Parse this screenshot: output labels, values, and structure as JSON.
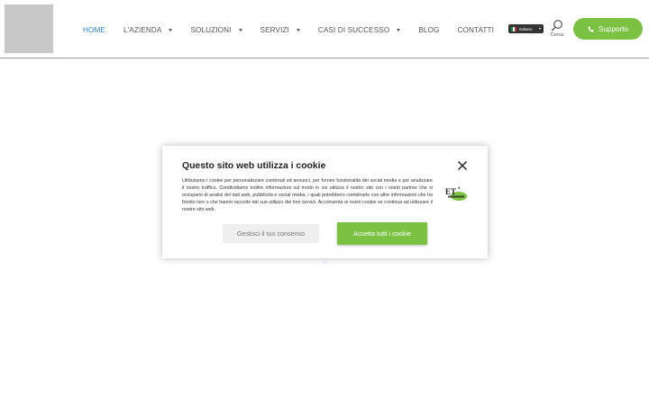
{
  "header": {
    "nav": [
      {
        "label": "Home",
        "active": true,
        "has_caret": false
      },
      {
        "label": "L'azienda",
        "active": false,
        "has_caret": true
      },
      {
        "label": "Soluzioni",
        "active": false,
        "has_caret": true
      },
      {
        "label": "Servizi",
        "active": false,
        "has_caret": true
      },
      {
        "label": "Casi di successo",
        "active": false,
        "has_caret": true
      },
      {
        "label": "Blog",
        "active": false,
        "has_caret": false
      },
      {
        "label": "Contatti",
        "active": false,
        "has_caret": false
      }
    ],
    "language": {
      "selected": "Italiano",
      "flag_icon": "italy-flag-icon"
    },
    "search": {
      "label": "Cerca",
      "icon": "search-icon"
    },
    "support_button": {
      "label": "Supporto",
      "icon": "phone-icon"
    }
  },
  "cookie_modal": {
    "title": "Questo sito web utilizza i cookie",
    "text": "Utilizziamo i cookie per personalizzare contenuti ed annunci, per fornire funzionalità dei social media e per analizzare il nostro traffico. Condividiamo inoltre informazioni sul modo in cui utilizza il nostro sito con i nostri partner che si occupano di analisi dei dati web, pubblicità e social media, i quali potrebbero combinarle con altre informazioni che ha fornito loro o che hanno raccolto dal suo utilizzo dei loro servizi. Acconsenta ai nostri cookie se continua ad utilizzare il nostro sito web.",
    "manage_label": "Gestisci il tuo consenso",
    "accept_label": "Accetta tutti i cookie",
    "close_icon": "close-icon",
    "brand_logo_text": "ET"
  },
  "colors": {
    "accent_green": "#7cc242",
    "nav_active": "#2a86c9",
    "nav_text": "#555555"
  }
}
